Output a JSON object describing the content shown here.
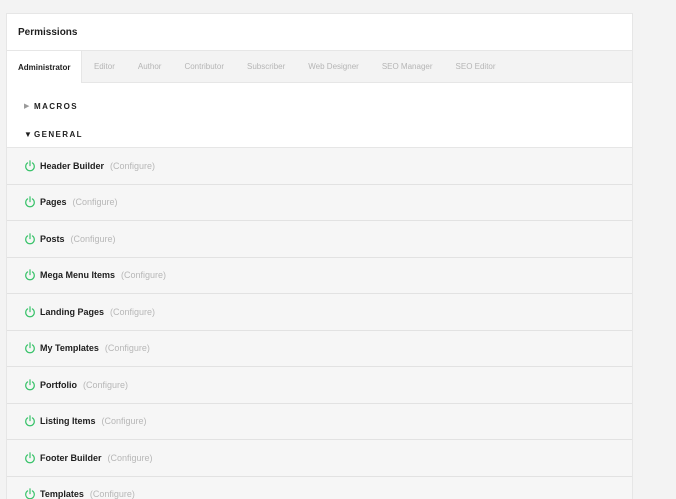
{
  "panel": {
    "title": "Permissions"
  },
  "tabs": [
    {
      "label": "Administrator",
      "active": true
    },
    {
      "label": "Editor",
      "active": false
    },
    {
      "label": "Author",
      "active": false
    },
    {
      "label": "Contributor",
      "active": false
    },
    {
      "label": "Subscriber",
      "active": false
    },
    {
      "label": "Web Designer",
      "active": false
    },
    {
      "label": "SEO Manager",
      "active": false
    },
    {
      "label": "SEO Editor",
      "active": false
    }
  ],
  "sections": {
    "macros": {
      "label": "MACROS",
      "caret": "▶",
      "expanded": false
    },
    "general": {
      "label": "GENERAL",
      "caret": "▼",
      "expanded": true
    }
  },
  "permissions": [
    {
      "name": "Header Builder",
      "configure": "(Configure)",
      "enabled": true
    },
    {
      "name": "Pages",
      "configure": "(Configure)",
      "enabled": true
    },
    {
      "name": "Posts",
      "configure": "(Configure)",
      "enabled": true
    },
    {
      "name": "Mega Menu Items",
      "configure": "(Configure)",
      "enabled": true
    },
    {
      "name": "Landing Pages",
      "configure": "(Configure)",
      "enabled": true
    },
    {
      "name": "My Templates",
      "configure": "(Configure)",
      "enabled": true
    },
    {
      "name": "Portfolio",
      "configure": "(Configure)",
      "enabled": true
    },
    {
      "name": "Listing Items",
      "configure": "(Configure)",
      "enabled": true
    },
    {
      "name": "Footer Builder",
      "configure": "(Configure)",
      "enabled": true
    },
    {
      "name": "Templates",
      "configure": "(Configure)",
      "enabled": true
    }
  ],
  "colors": {
    "power_on": "#3ac36b",
    "background": "#f3f3f3",
    "row_background": "#f6f6f6"
  },
  "icons": {
    "toggle": "power-icon"
  }
}
